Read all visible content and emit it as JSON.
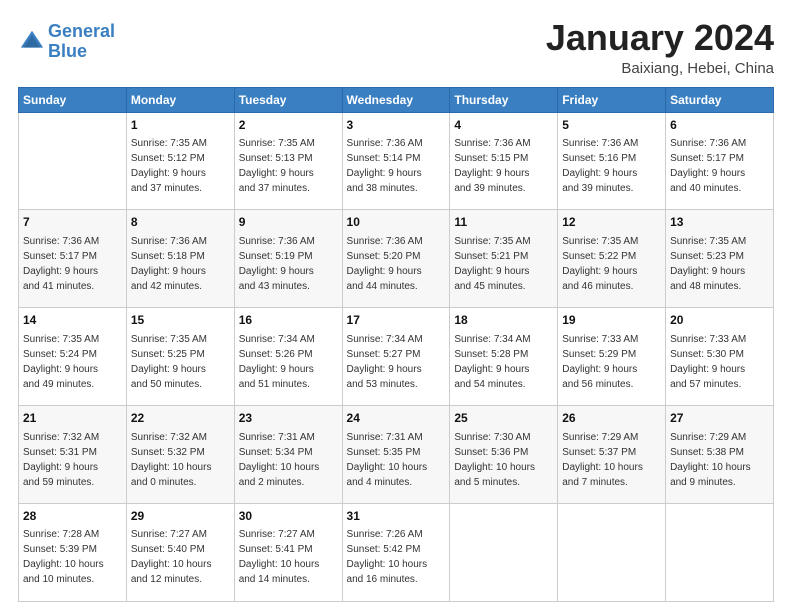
{
  "header": {
    "logo": {
      "line1": "General",
      "line2": "Blue"
    },
    "title": "January 2024",
    "location": "Baixiang, Hebei, China"
  },
  "days_of_week": [
    "Sunday",
    "Monday",
    "Tuesday",
    "Wednesday",
    "Thursday",
    "Friday",
    "Saturday"
  ],
  "weeks": [
    [
      {
        "day": "",
        "info": ""
      },
      {
        "day": "1",
        "info": "Sunrise: 7:35 AM\nSunset: 5:12 PM\nDaylight: 9 hours\nand 37 minutes."
      },
      {
        "day": "2",
        "info": "Sunrise: 7:35 AM\nSunset: 5:13 PM\nDaylight: 9 hours\nand 37 minutes."
      },
      {
        "day": "3",
        "info": "Sunrise: 7:36 AM\nSunset: 5:14 PM\nDaylight: 9 hours\nand 38 minutes."
      },
      {
        "day": "4",
        "info": "Sunrise: 7:36 AM\nSunset: 5:15 PM\nDaylight: 9 hours\nand 39 minutes."
      },
      {
        "day": "5",
        "info": "Sunrise: 7:36 AM\nSunset: 5:16 PM\nDaylight: 9 hours\nand 39 minutes."
      },
      {
        "day": "6",
        "info": "Sunrise: 7:36 AM\nSunset: 5:17 PM\nDaylight: 9 hours\nand 40 minutes."
      }
    ],
    [
      {
        "day": "7",
        "info": "Sunrise: 7:36 AM\nSunset: 5:17 PM\nDaylight: 9 hours\nand 41 minutes."
      },
      {
        "day": "8",
        "info": "Sunrise: 7:36 AM\nSunset: 5:18 PM\nDaylight: 9 hours\nand 42 minutes."
      },
      {
        "day": "9",
        "info": "Sunrise: 7:36 AM\nSunset: 5:19 PM\nDaylight: 9 hours\nand 43 minutes."
      },
      {
        "day": "10",
        "info": "Sunrise: 7:36 AM\nSunset: 5:20 PM\nDaylight: 9 hours\nand 44 minutes."
      },
      {
        "day": "11",
        "info": "Sunrise: 7:35 AM\nSunset: 5:21 PM\nDaylight: 9 hours\nand 45 minutes."
      },
      {
        "day": "12",
        "info": "Sunrise: 7:35 AM\nSunset: 5:22 PM\nDaylight: 9 hours\nand 46 minutes."
      },
      {
        "day": "13",
        "info": "Sunrise: 7:35 AM\nSunset: 5:23 PM\nDaylight: 9 hours\nand 48 minutes."
      }
    ],
    [
      {
        "day": "14",
        "info": "Sunrise: 7:35 AM\nSunset: 5:24 PM\nDaylight: 9 hours\nand 49 minutes."
      },
      {
        "day": "15",
        "info": "Sunrise: 7:35 AM\nSunset: 5:25 PM\nDaylight: 9 hours\nand 50 minutes."
      },
      {
        "day": "16",
        "info": "Sunrise: 7:34 AM\nSunset: 5:26 PM\nDaylight: 9 hours\nand 51 minutes."
      },
      {
        "day": "17",
        "info": "Sunrise: 7:34 AM\nSunset: 5:27 PM\nDaylight: 9 hours\nand 53 minutes."
      },
      {
        "day": "18",
        "info": "Sunrise: 7:34 AM\nSunset: 5:28 PM\nDaylight: 9 hours\nand 54 minutes."
      },
      {
        "day": "19",
        "info": "Sunrise: 7:33 AM\nSunset: 5:29 PM\nDaylight: 9 hours\nand 56 minutes."
      },
      {
        "day": "20",
        "info": "Sunrise: 7:33 AM\nSunset: 5:30 PM\nDaylight: 9 hours\nand 57 minutes."
      }
    ],
    [
      {
        "day": "21",
        "info": "Sunrise: 7:32 AM\nSunset: 5:31 PM\nDaylight: 9 hours\nand 59 minutes."
      },
      {
        "day": "22",
        "info": "Sunrise: 7:32 AM\nSunset: 5:32 PM\nDaylight: 10 hours\nand 0 minutes."
      },
      {
        "day": "23",
        "info": "Sunrise: 7:31 AM\nSunset: 5:34 PM\nDaylight: 10 hours\nand 2 minutes."
      },
      {
        "day": "24",
        "info": "Sunrise: 7:31 AM\nSunset: 5:35 PM\nDaylight: 10 hours\nand 4 minutes."
      },
      {
        "day": "25",
        "info": "Sunrise: 7:30 AM\nSunset: 5:36 PM\nDaylight: 10 hours\nand 5 minutes."
      },
      {
        "day": "26",
        "info": "Sunrise: 7:29 AM\nSunset: 5:37 PM\nDaylight: 10 hours\nand 7 minutes."
      },
      {
        "day": "27",
        "info": "Sunrise: 7:29 AM\nSunset: 5:38 PM\nDaylight: 10 hours\nand 9 minutes."
      }
    ],
    [
      {
        "day": "28",
        "info": "Sunrise: 7:28 AM\nSunset: 5:39 PM\nDaylight: 10 hours\nand 10 minutes."
      },
      {
        "day": "29",
        "info": "Sunrise: 7:27 AM\nSunset: 5:40 PM\nDaylight: 10 hours\nand 12 minutes."
      },
      {
        "day": "30",
        "info": "Sunrise: 7:27 AM\nSunset: 5:41 PM\nDaylight: 10 hours\nand 14 minutes."
      },
      {
        "day": "31",
        "info": "Sunrise: 7:26 AM\nSunset: 5:42 PM\nDaylight: 10 hours\nand 16 minutes."
      },
      {
        "day": "",
        "info": ""
      },
      {
        "day": "",
        "info": ""
      },
      {
        "day": "",
        "info": ""
      }
    ]
  ]
}
